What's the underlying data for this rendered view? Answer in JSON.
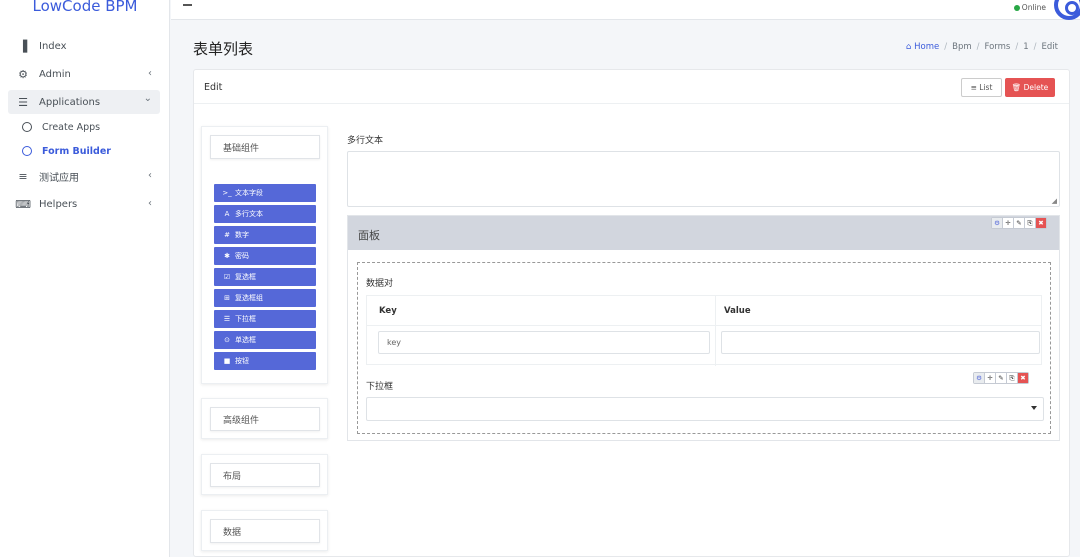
{
  "app": {
    "brand": "LowCode BPM"
  },
  "topbar": {
    "status": "Online"
  },
  "sidebar": {
    "items": [
      {
        "label": "Index",
        "icon": "bar-chart-icon",
        "glyph": "▐"
      },
      {
        "label": "Admin",
        "icon": "gear-icon",
        "glyph": "⚙",
        "chevron": "‹"
      },
      {
        "label": "Applications",
        "icon": "table-icon",
        "glyph": "☰",
        "chevron": "⌄"
      },
      {
        "label": "测试应用",
        "icon": "list-icon",
        "glyph": "≡",
        "chevron": "‹"
      },
      {
        "label": "Helpers",
        "icon": "keyboard-icon",
        "glyph": "⌨",
        "chevron": "‹"
      }
    ],
    "sub_items": [
      {
        "label": "Create Apps"
      },
      {
        "label": "Form Builder"
      }
    ]
  },
  "page": {
    "title": "表单列表",
    "breadcrumb": {
      "home": "Home",
      "items": [
        "Bpm",
        "Forms",
        "1",
        "Edit"
      ],
      "separator": "/"
    }
  },
  "card": {
    "title": "Edit",
    "list_btn": "≡ List",
    "delete_btn": "🗑 Delete"
  },
  "palette": {
    "groups": [
      "基础组件",
      "高级组件",
      "布局",
      "数据"
    ],
    "components": [
      {
        "glyph": ">_",
        "label": "文本字段",
        "icon": "terminal-icon"
      },
      {
        "glyph": "A",
        "label": "多行文本",
        "icon": "font-icon"
      },
      {
        "glyph": "#",
        "label": "数字",
        "icon": "hash-icon"
      },
      {
        "glyph": "✱",
        "label": "密码",
        "icon": "asterisk-icon"
      },
      {
        "glyph": "☑",
        "label": "复选框",
        "icon": "checkbox-icon"
      },
      {
        "glyph": "⊞",
        "label": "复选框组",
        "icon": "plus-square-icon"
      },
      {
        "glyph": "☰",
        "label": "下拉框",
        "icon": "list-icon"
      },
      {
        "glyph": "⊙",
        "label": "单选框",
        "icon": "radio-icon"
      },
      {
        "glyph": "■",
        "label": "按钮",
        "icon": "stop-icon"
      }
    ]
  },
  "form": {
    "textarea_label": "多行文本",
    "panel_title": "面板",
    "kv_label": "数据对",
    "kv_headers": [
      "Key",
      "Value"
    ],
    "kv_key_placeholder": "key",
    "select_label": "下拉框",
    "controls": [
      "⚙",
      "✛",
      "✎",
      "⎘",
      "✖"
    ]
  },
  "colors": {
    "accent": "#3b5bdb",
    "component": "#5568d8",
    "danger": "#e55353",
    "online": "#28a745"
  }
}
